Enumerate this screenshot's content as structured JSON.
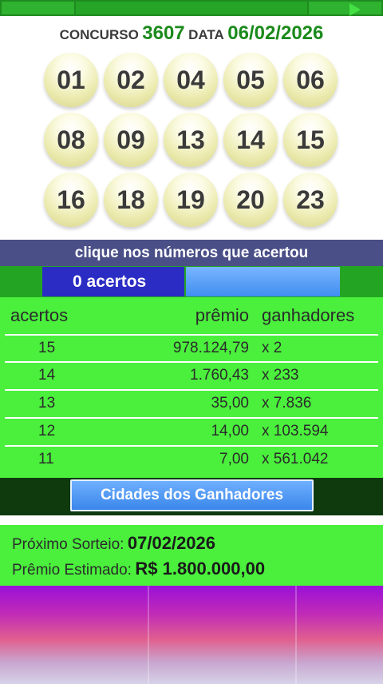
{
  "header": {
    "concurso_label": "CONCURSO",
    "concurso_number": "3607",
    "data_label": "DATA",
    "draw_date": "06/02/2026"
  },
  "balls": [
    "01",
    "02",
    "04",
    "05",
    "06",
    "08",
    "09",
    "13",
    "14",
    "15",
    "16",
    "18",
    "19",
    "20",
    "23"
  ],
  "hint": "clique nos números que acertou",
  "acertos_count": "0 acertos",
  "prize_table": {
    "headers": [
      "acertos",
      "prêmio",
      "ganhadores"
    ],
    "rows": [
      {
        "hits": "15",
        "prize": "978.124,79",
        "winners": "x 2"
      },
      {
        "hits": "14",
        "prize": "1.760,43",
        "winners": "x 233"
      },
      {
        "hits": "13",
        "prize": "35,00",
        "winners": "x 7.836"
      },
      {
        "hits": "12",
        "prize": "14,00",
        "winners": "x 103.594"
      },
      {
        "hits": "11",
        "prize": "7,00",
        "winners": "x 561.042"
      }
    ]
  },
  "cities_button": "Cidades dos Ganhadores",
  "next_draw": {
    "label": "Próximo Sorteio:",
    "date": "07/02/2026",
    "prize_label": "Prêmio Estimado:",
    "prize_value": "R$ 1.800.000,00"
  },
  "colors": {
    "green": "#4af03c",
    "header_green": "#1a8a1a",
    "hint_bg": "#4a4f88",
    "count_bg": "#2b2cc4",
    "button_blue": "#3a86ea"
  }
}
